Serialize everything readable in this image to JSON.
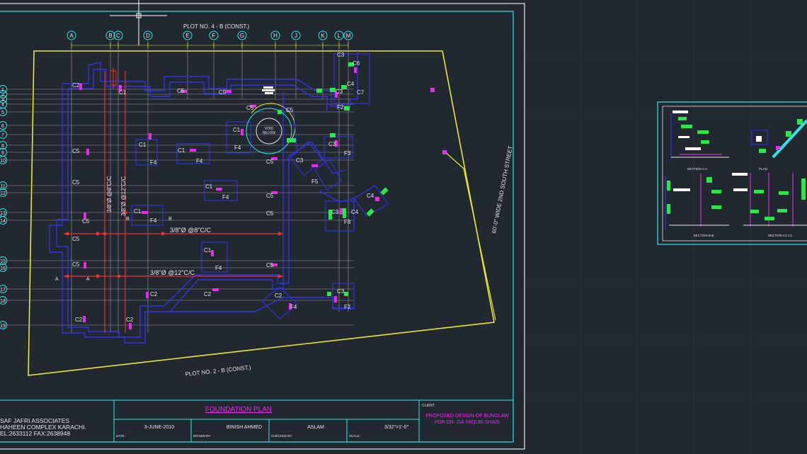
{
  "drawing": {
    "top_label": "PLOT NO. 4 - B (CONST.)",
    "bottom_label": "PLOT NO. 2 - B (CONST.)",
    "street_label": "60'-0\" WIDE 2ND SOUTH STREET",
    "void_label_1": "VOID",
    "void_label_2": "BELOW",
    "grid_columns": [
      "A",
      "B",
      "C",
      "D",
      "E",
      "F",
      "G",
      "H",
      "J",
      "K",
      "L",
      "M"
    ],
    "grid_rows": [
      "1",
      "2",
      "3",
      "4",
      "5",
      "6",
      "7",
      "8",
      "9",
      "10",
      "11",
      "12",
      "13",
      "14",
      "15",
      "16",
      "17",
      "18",
      "19"
    ],
    "column_labels": [
      {
        "id": "col-c2-a",
        "text": "C2"
      },
      {
        "id": "col-c1-a",
        "text": "C1"
      },
      {
        "id": "col-c5-a",
        "text": "C5"
      },
      {
        "id": "col-c5-b",
        "text": "C5"
      },
      {
        "id": "col-c5-c",
        "text": "C5"
      },
      {
        "id": "col-c5-d",
        "text": "C5"
      },
      {
        "id": "col-c3-a",
        "text": "C3"
      },
      {
        "id": "col-c6",
        "text": "C6"
      },
      {
        "id": "col-c4-a",
        "text": "C4"
      },
      {
        "id": "col-c3-b",
        "text": "C3"
      },
      {
        "id": "col-c7",
        "text": "C7"
      },
      {
        "id": "col-f2-a",
        "text": "F2"
      },
      {
        "id": "col-c1-b",
        "text": "C1"
      },
      {
        "id": "col-f4-a",
        "text": "F4"
      },
      {
        "id": "col-c1-c",
        "text": "C1"
      },
      {
        "id": "col-f4-b",
        "text": "F4"
      },
      {
        "id": "col-c1-d",
        "text": "C1"
      },
      {
        "id": "col-f4-c",
        "text": "F4"
      },
      {
        "id": "col-c5-e",
        "text": "C5"
      },
      {
        "id": "col-c3-c",
        "text": "C3"
      },
      {
        "id": "col-f3",
        "text": "F3"
      },
      {
        "id": "col-c3-d",
        "text": "C3"
      },
      {
        "id": "col-f5",
        "text": "F5"
      },
      {
        "id": "col-c5-f",
        "text": "C5"
      },
      {
        "id": "col-c1-e",
        "text": "C1"
      },
      {
        "id": "col-f4-d",
        "text": "F4"
      },
      {
        "id": "col-c5-g",
        "text": "C5"
      },
      {
        "id": "col-c4-b",
        "text": "C4"
      },
      {
        "id": "col-c3-e",
        "text": "C3"
      },
      {
        "id": "col-c4-c",
        "text": "C4"
      },
      {
        "id": "col-f8",
        "text": "F8"
      },
      {
        "id": "col-c1-f",
        "text": "C1"
      },
      {
        "id": "col-f4-e",
        "text": "F4"
      },
      {
        "id": "col-c5-h",
        "text": "C5"
      },
      {
        "id": "col-c5-i",
        "text": "C5"
      },
      {
        "id": "col-c1-g",
        "text": "C1"
      },
      {
        "id": "col-f4-f",
        "text": "F4"
      },
      {
        "id": "col-c5-j",
        "text": "C5"
      },
      {
        "id": "col-c5-k",
        "text": "C5"
      },
      {
        "id": "col-c2-b",
        "text": "C2"
      },
      {
        "id": "col-c2-c",
        "text": "C2"
      },
      {
        "id": "col-c2-d",
        "text": "C2"
      },
      {
        "id": "col-f4-g",
        "text": "F4"
      },
      {
        "id": "col-c3-f",
        "text": "C3"
      },
      {
        "id": "col-f2-b",
        "text": "F2"
      },
      {
        "id": "col-c2-e",
        "text": "C2"
      },
      {
        "id": "col-c2-f",
        "text": "C2"
      },
      {
        "id": "col-c5-l",
        "text": "C5"
      },
      {
        "id": "col-c5-m",
        "text": "C5"
      }
    ],
    "rebar_labels": [
      {
        "id": "rebar-h1",
        "text": "3/8\"Ø @8\"C/C"
      },
      {
        "id": "rebar-h2",
        "text": "3/8\"Ø @12\"C/C"
      },
      {
        "id": "rebar-v1",
        "text": "3/8\"Ø @8\"C/C"
      },
      {
        "id": "rebar-v2",
        "text": "3/8\"Ø @12\"C/C"
      }
    ],
    "section_marks": [
      "A",
      "A",
      "B",
      "B"
    ]
  },
  "detail_sheet": {
    "labels": [
      "SECTION A-A",
      "PLAN",
      "SECTION B-B",
      "SECTION C1-C1"
    ]
  },
  "title_block": {
    "firm_line1": "SAF JAFRI ASSOCIATES",
    "firm_line2": "HAHEEN COMPLEX KARACHI.",
    "firm_line3": "EL:2633112 FAX:2638948",
    "sheet_title": "FOUNDATION PLAN",
    "client_label": "CLIENT",
    "project_line1": "PROPOSED DESIGN OF BUNGLAW",
    "project_line2": "FOR DR. ZIA YAQUBI SHAIS",
    "date_value": "3-JUNE-2010",
    "date_label": "DATE:",
    "drawn_value": "BINISH AHMED",
    "drawn_label": "DRAWN BY:",
    "checked_value": "ASLAM",
    "checked_label": "CHECKED BY:",
    "scale_value": "3/32\"=1'-0\"",
    "scale_label": "SCALE:"
  },
  "colors": {
    "background": "#212830",
    "frame": "#e6e6e6",
    "plot_line": "#e8e830",
    "wall": "#3232e6",
    "column": "#e62ee6",
    "rebar": "#e63232",
    "grid": "#9a9a9a",
    "bubble": "#2ee6e6",
    "callout": "#2ee64b",
    "title_magenta": "#e62ee6"
  }
}
